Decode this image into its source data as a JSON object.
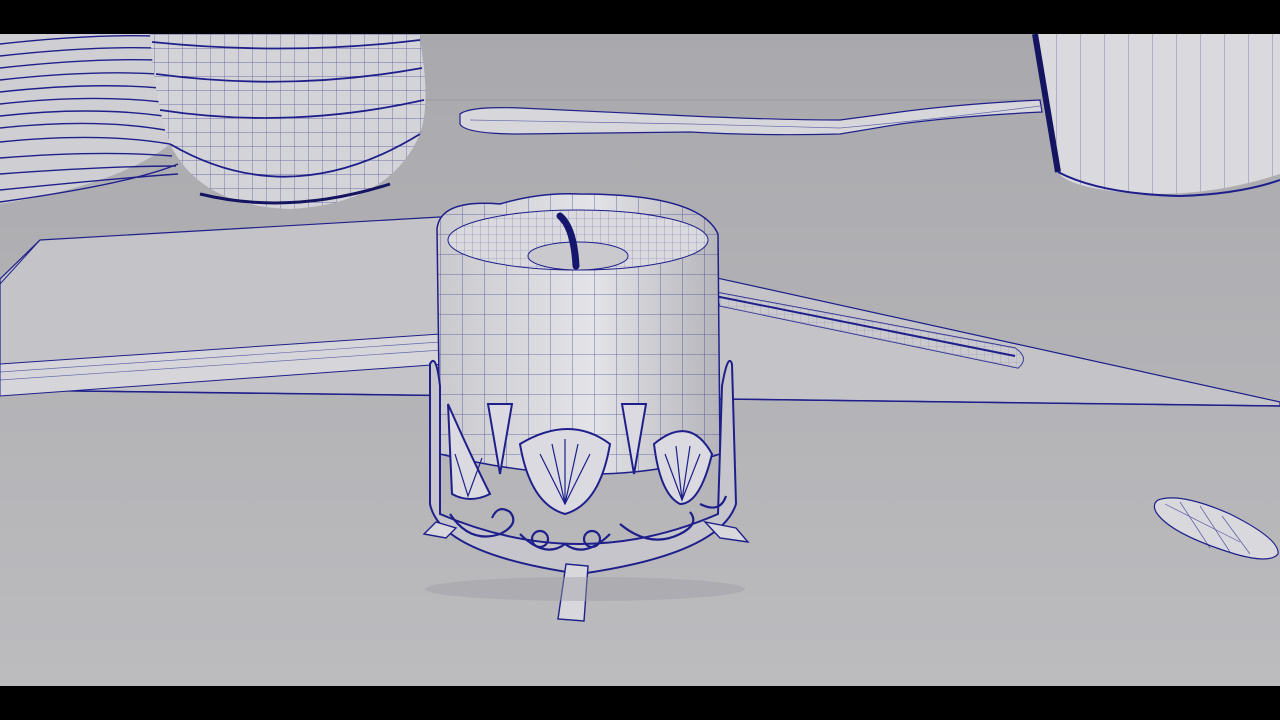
{
  "viewport": {
    "background_color": "#b9b9bb",
    "letterbox_color": "#000000",
    "wire_color": "#1f1f8c",
    "surface_color": "#d2d2d6",
    "shadow_color": "#8e8e96"
  },
  "scene": {
    "objects": [
      "stacked-plates",
      "stacked-bowls",
      "cutting-board",
      "rolling-pin",
      "fork",
      "knife",
      "candle",
      "candle-holder",
      "cup",
      "spoon"
    ]
  }
}
